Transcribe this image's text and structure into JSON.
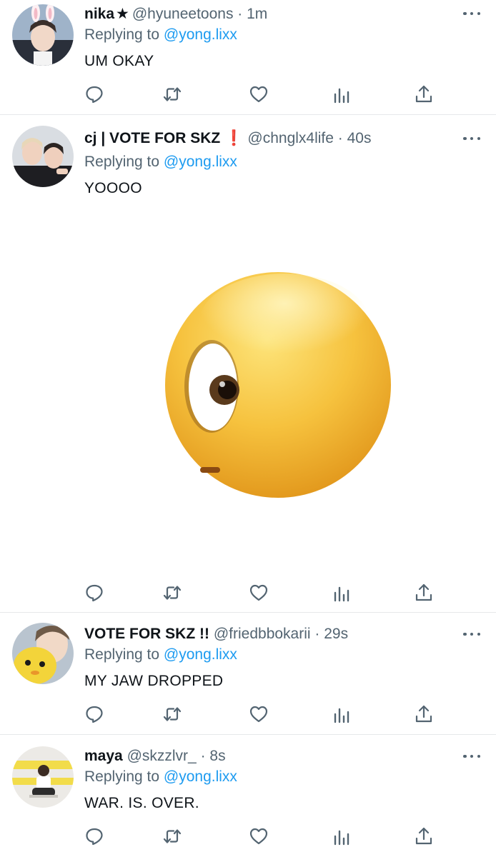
{
  "tweets": [
    {
      "name": "nika",
      "badge": "★",
      "handle": "@hyuneetoons",
      "time": "· 1m",
      "replying_prefix": "Replying to ",
      "replying_to": "@yong.lixx",
      "text": "UM OKAY"
    },
    {
      "name": "cj | VOTE FOR SKZ",
      "badge": "❗",
      "handle": "@chnglx4life",
      "time": "· 40s",
      "replying_prefix": "Replying to ",
      "replying_to": "@yong.lixx",
      "text": "YOOOO",
      "media_icon": "face-with-rolling-eyes-emoji"
    },
    {
      "name": "VOTE FOR SKZ !!",
      "handle": "@friedbbokarii",
      "time": "· 29s",
      "replying_prefix": "Replying to ",
      "replying_to": "@yong.lixx",
      "text": "MY JAW DROPPED"
    },
    {
      "name": "maya",
      "handle": "@skzzlvr_",
      "time": "· 8s",
      "replying_prefix": "Replying to ",
      "replying_to": "@yong.lixx",
      "text": "WAR. IS. OVER."
    }
  ],
  "action_icons": [
    "reply-icon",
    "retweet-icon",
    "like-icon",
    "views-icon",
    "share-icon"
  ],
  "more_icon": "more-options-icon",
  "colors": {
    "text": "#0f1419",
    "secondary": "#536471",
    "link": "#1d9bf0",
    "divider": "#e6e8ea",
    "alert": "#e0245e"
  }
}
